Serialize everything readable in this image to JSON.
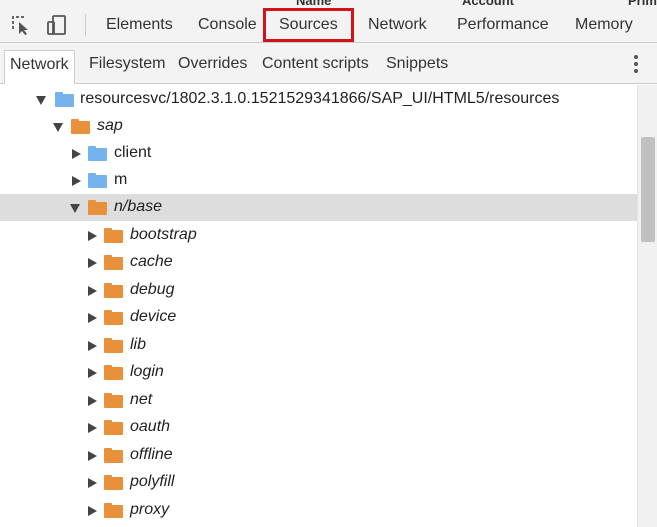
{
  "background_page": {
    "columns": [
      "Name",
      "Account",
      "Prim"
    ]
  },
  "toolbar": {
    "inspect_icon": "inspect-element-icon",
    "device_icon": "device-toolbar-icon",
    "tabs": [
      "Elements",
      "Console",
      "Sources",
      "Network",
      "Performance",
      "Memory"
    ],
    "selected_tab": "Sources",
    "highlight_color": "#d0121a"
  },
  "navigator": {
    "tabs": [
      "Network",
      "Filesystem",
      "Overrides",
      "Content scripts",
      "Snippets"
    ],
    "selected_tab": "Network",
    "more_icon": "more-vertical-icon"
  },
  "tree": {
    "root": "resourcesvc/1802.3.1.0.1521529341866/SAP_UI/HTML5/resources",
    "sap": "sap",
    "client": "client",
    "m": "m",
    "n_base": "n/base",
    "children": [
      "bootstrap",
      "cache",
      "debug",
      "device",
      "lib",
      "login",
      "net",
      "oauth",
      "offline",
      "polyfill",
      "proxy"
    ]
  },
  "colors": {
    "folder_blue": "#75b3ee",
    "folder_orange": "#e8913a",
    "selected_row": "#dddddd"
  }
}
